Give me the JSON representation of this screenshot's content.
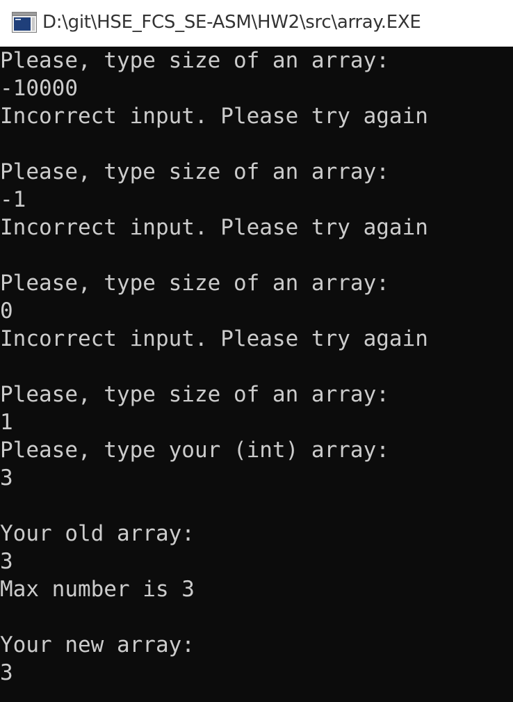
{
  "window": {
    "title": "D:\\git\\HSE_FCS_SE-ASM\\HW2\\src\\array.EXE",
    "icon": "console-app-icon",
    "background_color": "#0c0c0c",
    "text_color": "#cccccc"
  },
  "console": {
    "lines": [
      "Please, type size of an array:",
      "-10000",
      "Incorrect input. Please try again",
      "",
      "Please, type size of an array:",
      "-1",
      "Incorrect input. Please try again",
      "",
      "Please, type size of an array:",
      "0",
      "Incorrect input. Please try again",
      "",
      "Please, type size of an array:",
      "1",
      "Please, type your (int) array:",
      "3",
      "",
      "Your old array:",
      "3",
      "Max number is 3",
      "",
      "Your new array:",
      "3"
    ]
  }
}
